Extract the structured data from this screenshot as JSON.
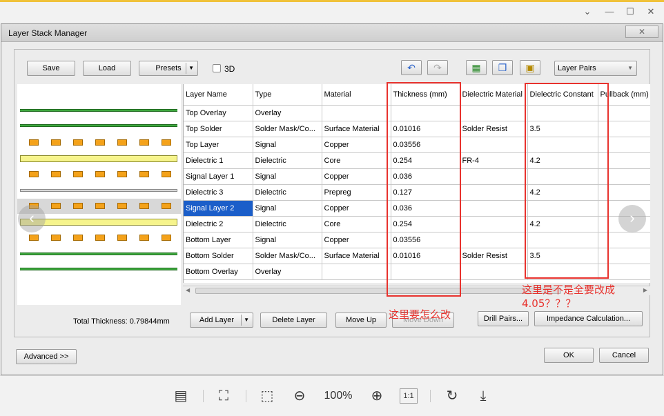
{
  "window": {
    "title": "Layer Stack Manager",
    "close_glyph": "✕"
  },
  "toolbar": {
    "save": "Save",
    "load": "Load",
    "presets": "Presets",
    "three_d": "3D",
    "view_mode": "Layer Pairs"
  },
  "table": {
    "headers": [
      "Layer Name",
      "Type",
      "Material",
      "Thickness (mm)",
      "Dielectric Material",
      "Dielectric Constant",
      "Pullback (mm)"
    ],
    "rows": [
      [
        "Top Overlay",
        "Overlay",
        "",
        "",
        "",
        "",
        ""
      ],
      [
        "Top Solder",
        "Solder Mask/Co...",
        "Surface Material",
        "0.01016",
        "Solder Resist",
        "3.5",
        ""
      ],
      [
        "Top Layer",
        "Signal",
        "Copper",
        "0.03556",
        "",
        "",
        ""
      ],
      [
        "Dielectric 1",
        "Dielectric",
        "Core",
        "0.254",
        "FR-4",
        "4.2",
        ""
      ],
      [
        "Signal Layer 1",
        "Signal",
        "Copper",
        "0.036",
        "",
        "",
        ""
      ],
      [
        "Dielectric 3",
        "Dielectric",
        "Prepreg",
        "0.127",
        "",
        "4.2",
        ""
      ],
      [
        "Signal Layer 2",
        "Signal",
        "Copper",
        "0.036",
        "",
        "",
        ""
      ],
      [
        "Dielectric 2",
        "Dielectric",
        "Core",
        "0.254",
        "",
        "4.2",
        ""
      ],
      [
        "Bottom Layer",
        "Signal",
        "Copper",
        "0.03556",
        "",
        "",
        ""
      ],
      [
        "Bottom Solder",
        "Solder Mask/Co...",
        "Surface Material",
        "0.01016",
        "Solder Resist",
        "3.5",
        ""
      ],
      [
        "Bottom Overlay",
        "Overlay",
        "",
        "",
        "",
        "",
        ""
      ]
    ],
    "selected_row": 6
  },
  "footer": {
    "total_thickness": "Total Thickness: 0.79844mm",
    "add_layer": "Add Layer",
    "delete_layer": "Delete Layer",
    "move_up": "Move Up",
    "move_down": "Move Down",
    "drill_pairs": "Drill Pairs...",
    "impedance": "Impedance Calculation...",
    "advanced": "Advanced >>",
    "ok": "OK",
    "cancel": "Cancel"
  },
  "annotations": {
    "thickness_note": "这里要怎么改",
    "dielectric_note_line1": "这里是不是全要改成",
    "dielectric_note_line2": "4.05？？？"
  },
  "viewer": {
    "zoom": "100%",
    "one_to_one": "1:1"
  },
  "colors": {
    "annotation_red": "#e8322d",
    "selection_blue": "#1b5ec9",
    "layer_green": "#3ea83e",
    "dielectric_yellow": "#f6f48c",
    "pad_orange": "#f4a21a"
  }
}
